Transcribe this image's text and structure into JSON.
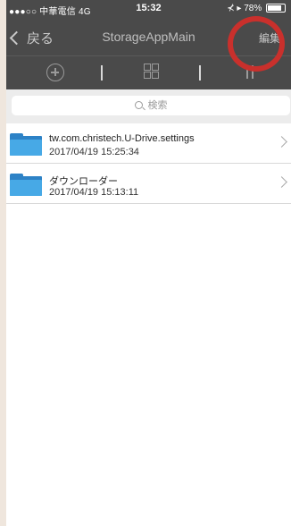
{
  "status_bar": {
    "carrier": "●●●○○ 中華電信  4G",
    "time": "15:32",
    "right": "⊀ ▸ 78%"
  },
  "nav": {
    "back_label": "戻る",
    "title": "StorageAppMain",
    "edit_label": "編集"
  },
  "toolbar": {
    "add_icon": "plus-circle-icon",
    "grid_icon": "grid-icon",
    "sort_icon": "sort-icon"
  },
  "search": {
    "placeholder": "検索"
  },
  "files": [
    {
      "name": "tw.com.christech.U-Drive.settings",
      "date": "2017/04/19 15:25:34",
      "icon": "folder-icon"
    },
    {
      "name": "ダウンローダー",
      "date": "2017/04/19 15:13:11",
      "icon": "folder-icon"
    }
  ],
  "colors": {
    "bar_bg": "#4a4a4a",
    "folder_blue": "#47a9e6",
    "annotation_red": "#c9302c"
  }
}
